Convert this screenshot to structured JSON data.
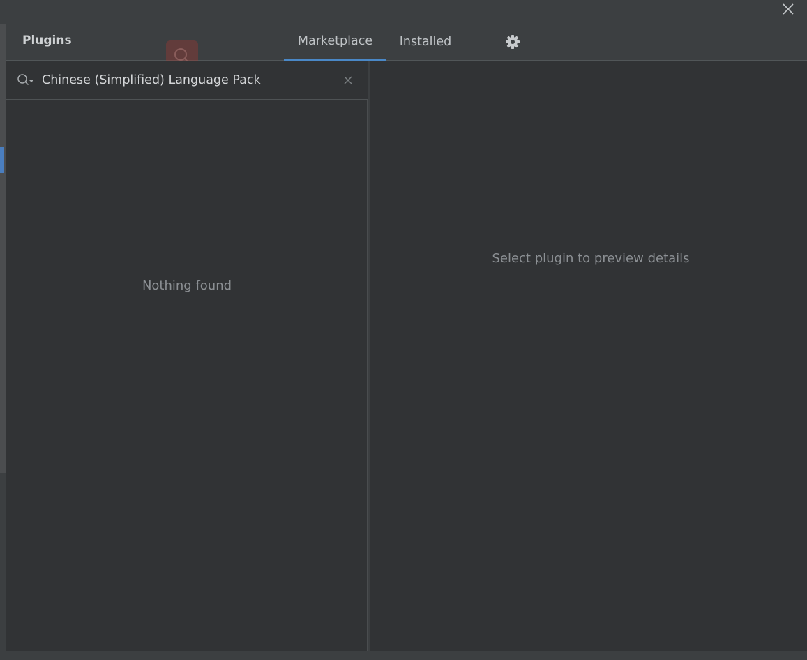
{
  "window": {
    "close_icon": "close-icon"
  },
  "header": {
    "title": "Plugins",
    "tabs": [
      {
        "label": "Marketplace",
        "active": true
      },
      {
        "label": "Installed",
        "active": false
      }
    ],
    "settings_icon": "gear-icon"
  },
  "search": {
    "value": "Chinese (Simplified) Language Pack",
    "placeholder": "",
    "search_icon": "search-icon",
    "clear_icon": "clear-icon"
  },
  "results": {
    "empty_message": "Nothing found"
  },
  "details": {
    "empty_message": "Select plugin to preview details"
  },
  "colors": {
    "background": "#3c3f41",
    "panel": "#313335",
    "accent": "#4a88c7",
    "muted_text": "#8c9094"
  }
}
